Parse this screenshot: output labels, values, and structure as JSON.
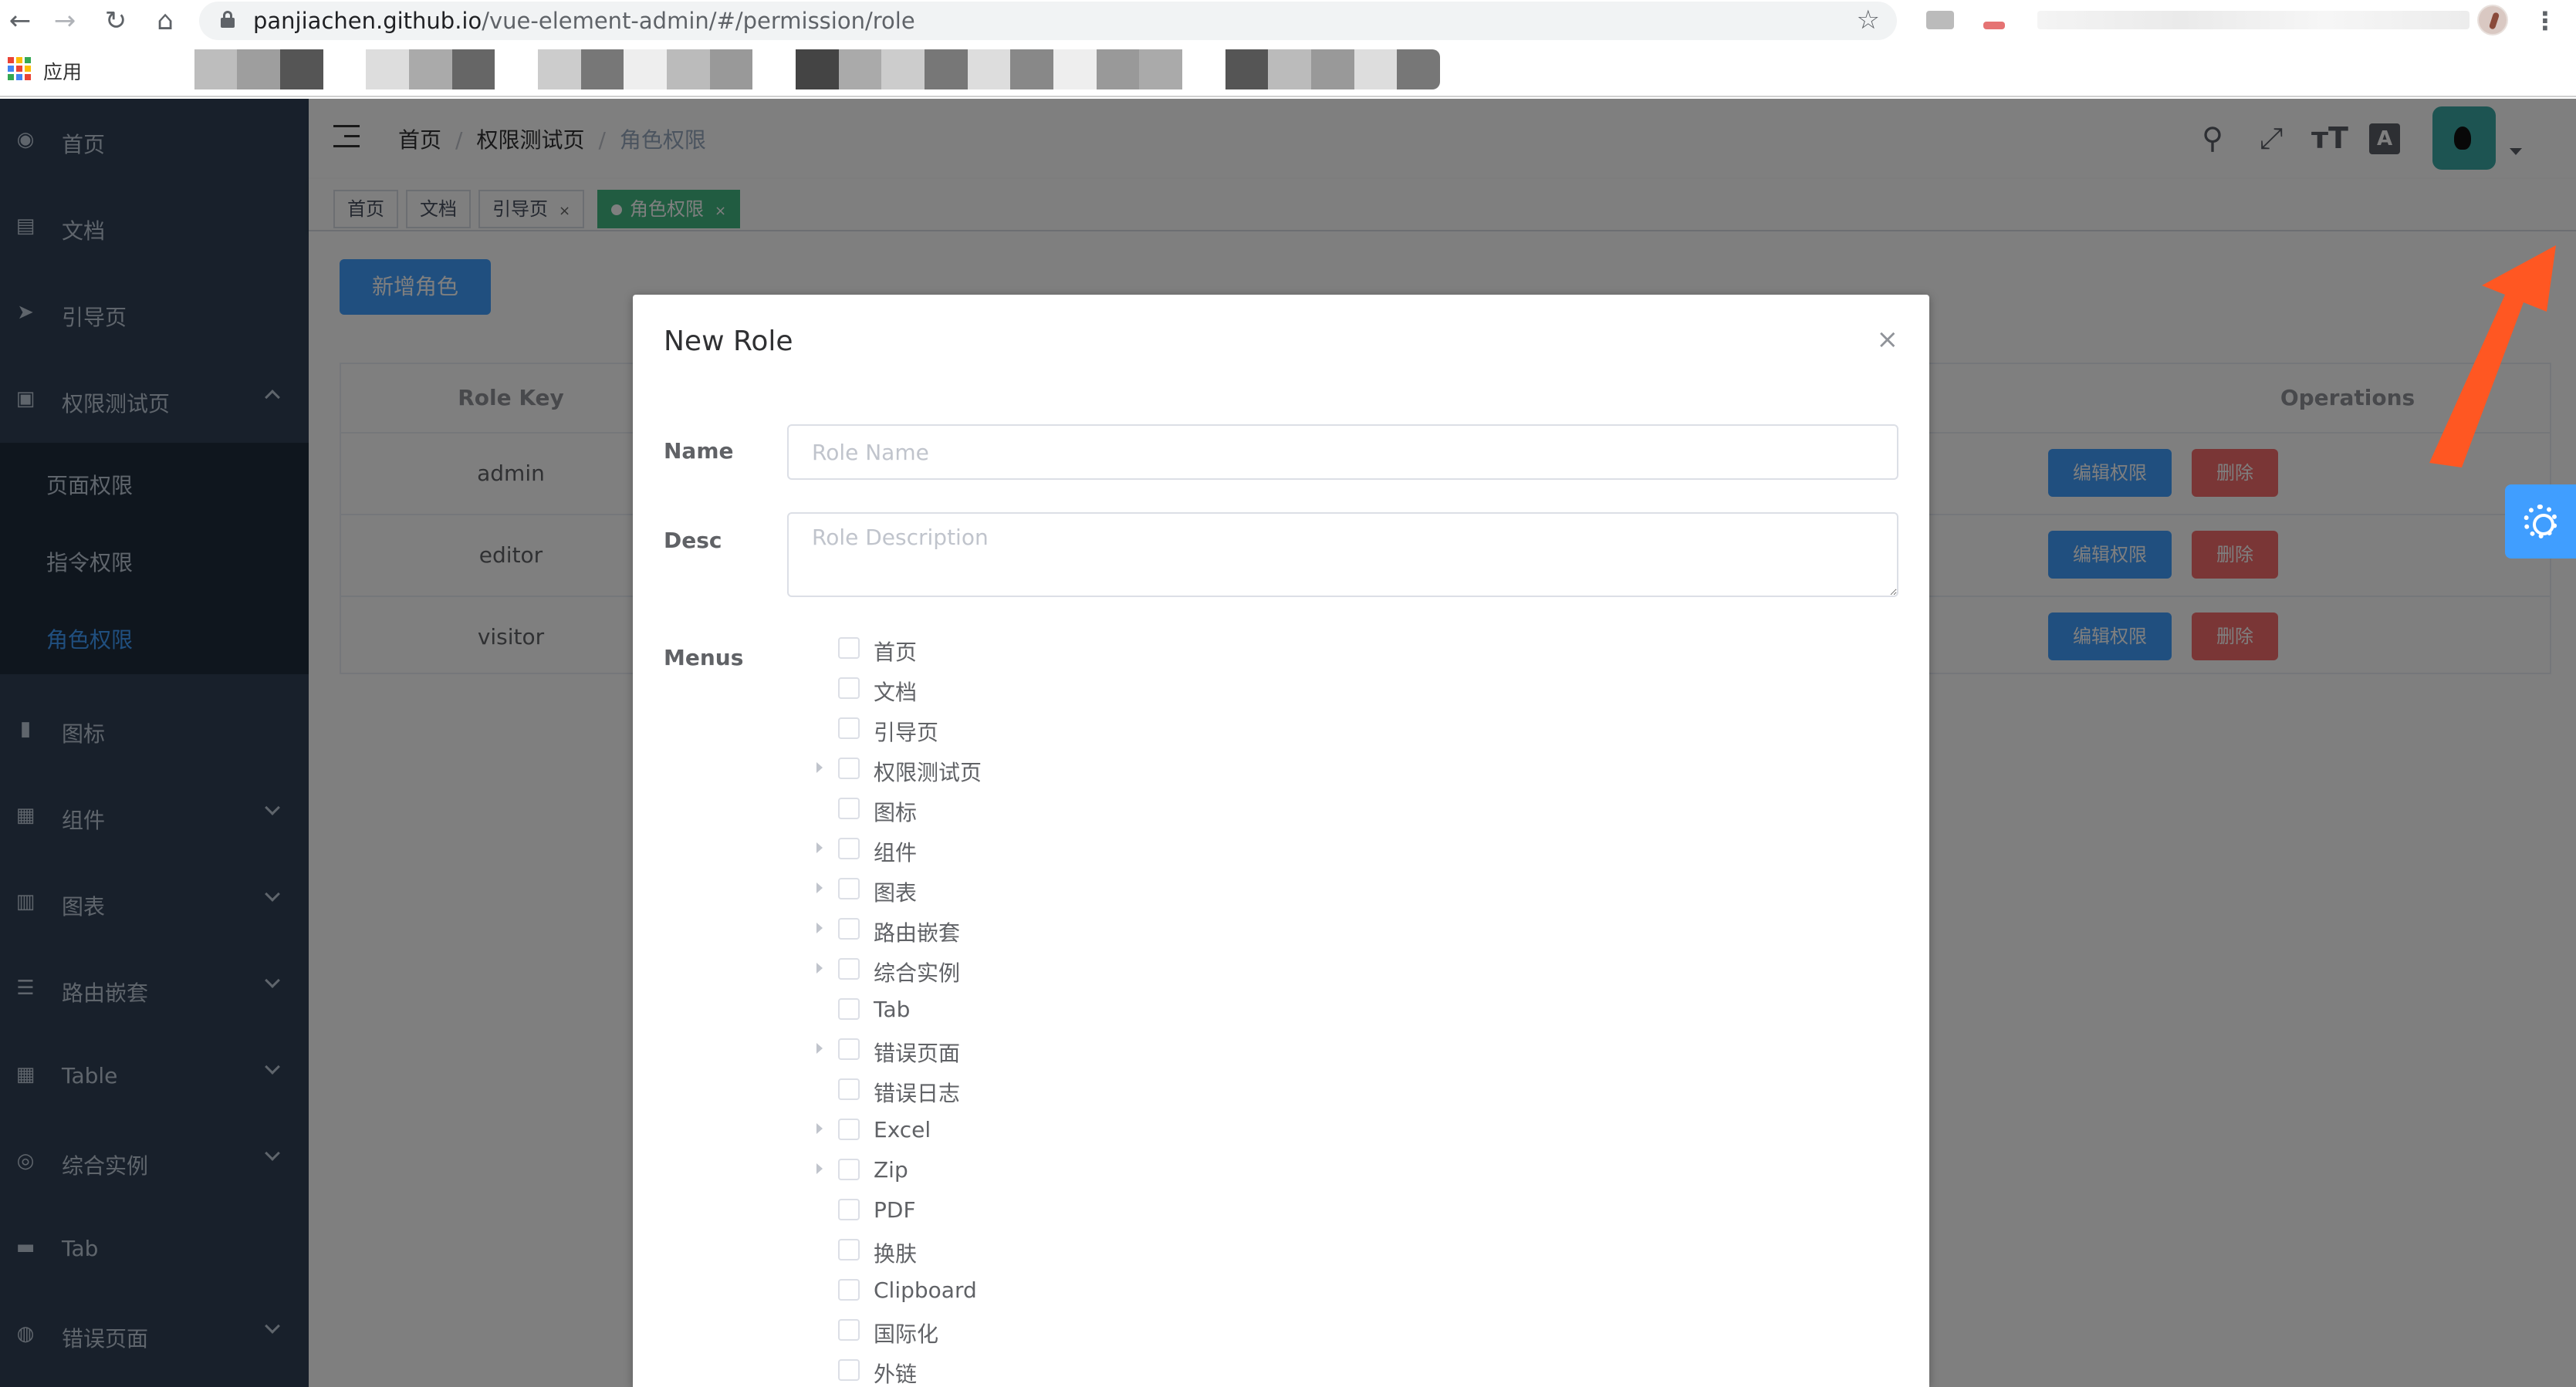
{
  "browser": {
    "url_host": "panjiachen.github.io",
    "url_path": "/vue-element-admin/#/permission/role",
    "bookmarks_label": "应用",
    "back_icon": "←",
    "forward_icon": "→",
    "reload_icon": "↻",
    "home_icon": "⌂",
    "star_icon": "☆",
    "menu_icon": "⋮"
  },
  "sidebar": {
    "items": [
      {
        "label": "首页",
        "icon": "◉"
      },
      {
        "label": "文档",
        "icon": "▤"
      },
      {
        "label": "引导页",
        "icon": "➤"
      },
      {
        "label": "权限测试页",
        "icon": "▣"
      },
      {
        "label": "图标",
        "icon": "▮"
      },
      {
        "label": "组件",
        "icon": "▦"
      },
      {
        "label": "图表",
        "icon": "▥"
      },
      {
        "label": "路由嵌套",
        "icon": "☰"
      },
      {
        "label": "Table",
        "icon": "▦"
      },
      {
        "label": "综合实例",
        "icon": "◎"
      },
      {
        "label": "Tab",
        "icon": "▬"
      },
      {
        "label": "错误页面",
        "icon": "◍"
      }
    ],
    "submenu": [
      "页面权限",
      "指令权限",
      "角色权限"
    ]
  },
  "navbar": {
    "breadcrumb": [
      "首页",
      "权限测试页",
      "角色权限"
    ],
    "tools": [
      "⚲",
      "⤢",
      "ᴛT",
      "A"
    ]
  },
  "tags": [
    {
      "label": "首页",
      "closable": false
    },
    {
      "label": "文档",
      "closable": false
    },
    {
      "label": "引导页",
      "closable": true
    },
    {
      "label": "角色权限",
      "closable": true,
      "active": true
    }
  ],
  "main": {
    "add_role_button": "新增角色",
    "table": {
      "headers": [
        "Role Key",
        "Operations"
      ],
      "rows": [
        {
          "key": "admin",
          "edit": "编辑权限",
          "delete": "删除"
        },
        {
          "key": "editor",
          "edit": "编辑权限",
          "delete": "删除"
        },
        {
          "key": "visitor",
          "edit": "编辑权限",
          "delete": "删除"
        }
      ]
    }
  },
  "dialog": {
    "title": "New Role",
    "close_icon": "×",
    "name_label": "Name",
    "name_placeholder": "Role Name",
    "desc_label": "Desc",
    "desc_placeholder": "Role Description",
    "menus_label": "Menus",
    "menus": [
      {
        "label": "首页",
        "expandable": false
      },
      {
        "label": "文档",
        "expandable": false
      },
      {
        "label": "引导页",
        "expandable": false
      },
      {
        "label": "权限测试页",
        "expandable": true
      },
      {
        "label": "图标",
        "expandable": false
      },
      {
        "label": "组件",
        "expandable": true
      },
      {
        "label": "图表",
        "expandable": true
      },
      {
        "label": "路由嵌套",
        "expandable": true
      },
      {
        "label": "综合实例",
        "expandable": true
      },
      {
        "label": "Tab",
        "expandable": false
      },
      {
        "label": "错误页面",
        "expandable": true
      },
      {
        "label": "错误日志",
        "expandable": false
      },
      {
        "label": "Excel",
        "expandable": true
      },
      {
        "label": "Zip",
        "expandable": true
      },
      {
        "label": "PDF",
        "expandable": false
      },
      {
        "label": "换肤",
        "expandable": false
      },
      {
        "label": "Clipboard",
        "expandable": false
      },
      {
        "label": "国际化",
        "expandable": false
      },
      {
        "label": "外链",
        "expandable": false
      }
    ]
  },
  "colors": {
    "sidebar_bg": "#304156",
    "submenu_bg": "#1f2d3d",
    "primary": "#409eff",
    "danger": "#f56c6c",
    "tag_active": "#42b983",
    "annotation_arrow": "#ff5722"
  }
}
